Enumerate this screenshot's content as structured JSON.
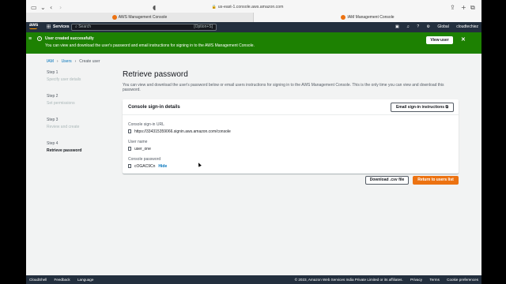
{
  "browser": {
    "url": "us-east-1.console.aws.amazon.com",
    "tabs": [
      {
        "label": "AWS Management Console"
      },
      {
        "label": "IAM Management Console"
      }
    ]
  },
  "topnav": {
    "logo": "aws",
    "services": "Services",
    "search_placeholder": "Search",
    "search_shortcut": "[Option+S]",
    "region": "Global",
    "account": "cloudtechiez"
  },
  "flash": {
    "title": "User created successfully",
    "message": "You can view and download the user's password and email instructions for signing in to the AWS Management Console.",
    "view_user": "View user"
  },
  "breadcrumb": [
    "IAM",
    "Users",
    "Create user"
  ],
  "steps": [
    {
      "num": "Step 1",
      "label": "Specify user details"
    },
    {
      "num": "Step 2",
      "label": "Set permissions"
    },
    {
      "num": "Step 3",
      "label": "Review and create"
    },
    {
      "num": "Step 4",
      "label": "Retrieve password"
    }
  ],
  "main": {
    "title": "Retrieve password",
    "description": "You can view and download the user's password below or email users instructions for signing in to the AWS Management Console. This is the only time you can view and download this password.",
    "panel_title": "Console sign-in details",
    "email_button": "Email sign-in instructions",
    "signin_url_label": "Console sign-in URL",
    "signin_url": "https://334315359066.signin.aws.amazon.com/console",
    "username_label": "User name",
    "username": "user_one",
    "password_label": "Console password",
    "password": "cOGAC9Cn",
    "hide": "Hide"
  },
  "actions": {
    "download": "Download .csv file",
    "return": "Return to users list"
  },
  "footer": {
    "cloudshell": "CloudShell",
    "feedback": "Feedback",
    "language": "Language",
    "copyright": "© 2023, Amazon Web Services India Private Limited or its affiliates.",
    "privacy": "Privacy",
    "terms": "Terms",
    "cookies": "Cookie preferences"
  }
}
